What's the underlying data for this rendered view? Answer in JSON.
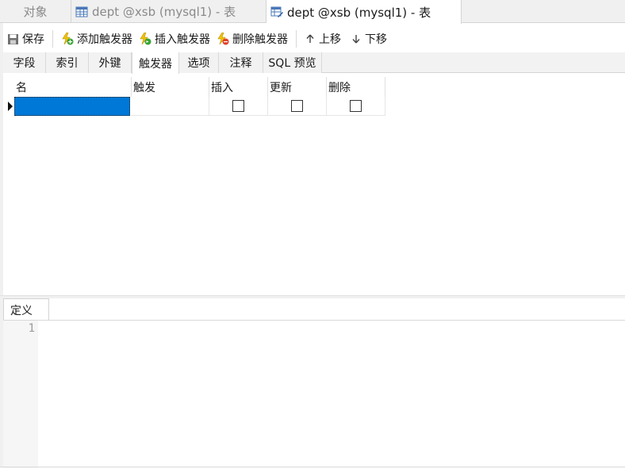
{
  "doc_tabs": [
    {
      "label": "对象"
    },
    {
      "label": "dept @xsb (mysql1) - 表"
    },
    {
      "label": "dept @xsb (mysql1) - 表"
    }
  ],
  "toolbar": {
    "save": "保存",
    "add_trigger": "添加触发器",
    "insert_trigger": "插入触发器",
    "delete_trigger": "删除触发器",
    "move_up": "上移",
    "move_down": "下移"
  },
  "object_tabs": [
    "字段",
    "索引",
    "外键",
    "触发器",
    "选项",
    "注释",
    "SQL 预览"
  ],
  "grid": {
    "columns": [
      "名",
      "触发",
      "插入",
      "更新",
      "删除"
    ],
    "rows": [
      {
        "name": "",
        "fires": "",
        "insert": false,
        "update": false,
        "delete": false
      }
    ]
  },
  "definition": {
    "tab": "定义",
    "line_numbers": [
      "1"
    ]
  },
  "colors": {
    "selection": "#0078d7",
    "accent_green": "#3aa335",
    "accent_yellow": "#f2c200",
    "accent_red": "#e0402a"
  }
}
